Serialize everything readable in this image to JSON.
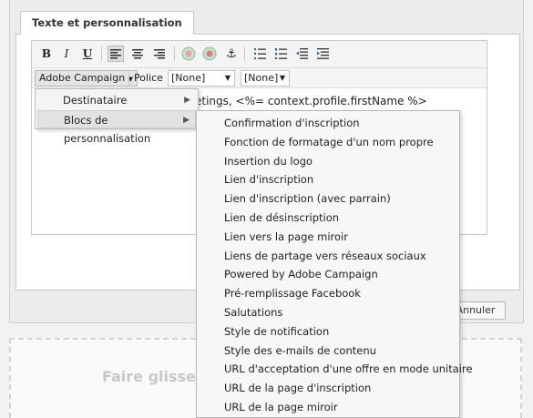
{
  "tab": {
    "label": "Texte et personnalisation"
  },
  "toolbar": {
    "bold": "B",
    "italic": "I",
    "underline": "U",
    "campaign_menu": "Adobe Campaign",
    "font_label": "Police",
    "font_select": "[None]",
    "size_select": "[None]"
  },
  "editor": {
    "content": "etings, <%= context.profile.firstName %>"
  },
  "menu": {
    "items": [
      {
        "label": "Destinataire"
      },
      {
        "label": "Blocs de personnalisation"
      }
    ]
  },
  "submenu": {
    "items": [
      "Confirmation d'inscription",
      "Fonction de formatage d'un nom propre",
      "Insertion du logo",
      "Lien d'inscription",
      "Lien d'inscription (avec parrain)",
      "Lien de désinscription",
      "Lien vers la page miroir",
      "Liens de partage vers réseaux sociaux",
      "Powered by Adobe Campaign",
      "Pré-remplissage Facebook",
      "Salutations",
      "Style de notification",
      "Style des e-mails de contenu",
      "URL d'acceptation d'une offre en mode unitaire",
      "URL de la page d'inscription",
      "URL de la page miroir"
    ]
  },
  "buttons": {
    "cancel": "Annuler"
  },
  "dropzone": {
    "text": "Faire glisser"
  }
}
